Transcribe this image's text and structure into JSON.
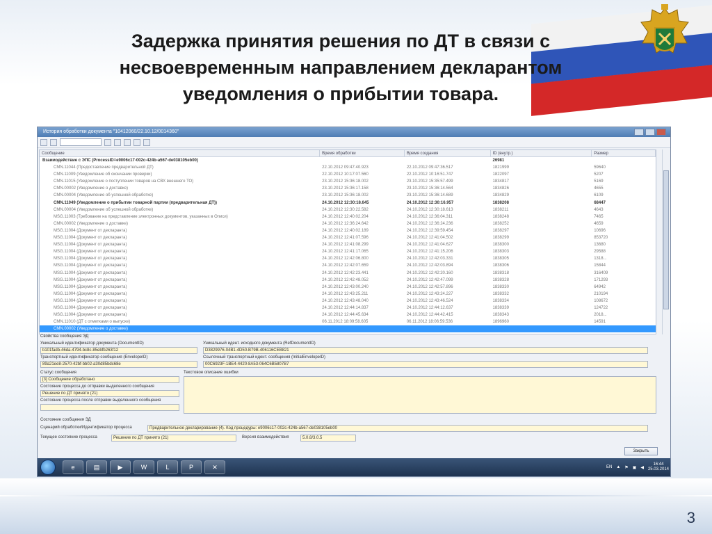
{
  "slide": {
    "title_line1": "Задержка принятия решения по ДТ в связи с",
    "title_line2": "несвоевременным направлением декларантом",
    "title_line3": "уведомления о прибытии товара.",
    "page_number": "3"
  },
  "window": {
    "title": "История обработки документа \"10412060/22.10.12/0014360\"",
    "close_button": "Закрыть"
  },
  "tree": {
    "columns": [
      "Сообщение",
      "Время обработки",
      "Время создания",
      "ID (внутр.)",
      "Размер"
    ],
    "rows": [
      {
        "name": "Взаимодействие с ЭПС (ProcessID=e9006c17-002c-424b-a567-de038105eb00)",
        "proc": "",
        "created": "",
        "id": "26981",
        "size": "",
        "bold": true
      },
      {
        "name": "CMN.11044 (Предоставление предварительной ДТ)",
        "proc": "22.10.2012 09:47:40.923",
        "created": "22.10.2012 09:47:36.517",
        "id": "1821999",
        "size": "59640"
      },
      {
        "name": "CMN.11009 (Уведомление об окончании проверки)",
        "proc": "22.10.2012 10:17:07.560",
        "created": "22.10.2012 10:16:51.747",
        "id": "1822097",
        "size": "5207"
      },
      {
        "name": "CMN.11015 (Уведомление о поступлении товаров на СВХ внешнего ТО)",
        "proc": "23.10.2012 15:36:18.002",
        "created": "23.10.2012 15:35:57.499",
        "id": "1834817",
        "size": "5169"
      },
      {
        "name": "CMN.00002 (Уведомление о доставке)",
        "proc": "23.10.2012 15:36:17.158",
        "created": "23.10.2012 15:36:14.564",
        "id": "1834826",
        "size": "4655"
      },
      {
        "name": "CMN.00004 (Уведомление об успешной обработке)",
        "proc": "23.10.2012 15:36:18.002",
        "created": "23.10.2012 15:36:14.689",
        "id": "1834829",
        "size": "6109"
      },
      {
        "name": "CMN.11049 (Уведомление о прибытии товарной партии (предварительная ДТ))",
        "proc": "24.10.2012 12:30:18.645",
        "created": "24.10.2012 12:30:16.957",
        "id": "1838208",
        "size": "68447",
        "bold": true
      },
      {
        "name": "CMN.00004 (Уведомление об успешной обработке)",
        "proc": "24.10.2012 12:30:22.582",
        "created": "24.10.2012 12:30:18.613",
        "id": "1838211",
        "size": "4643"
      },
      {
        "name": "MSG.11003 (Требование на представление электронных документов, указанных в Описи)",
        "proc": "24.10.2012 12:40:02.204",
        "created": "24.10.2012 12:36:04.311",
        "id": "1838248",
        "size": "7465"
      },
      {
        "name": "CMN.00002 (Уведомление о доставке)",
        "proc": "24.10.2012 12:36:24.642",
        "created": "24.10.2012 12:36:24.236",
        "id": "1838252",
        "size": "4659"
      },
      {
        "name": "MSG.11004 (Документ от декларанта)",
        "proc": "24.10.2012 12:40:02.189",
        "created": "24.10.2012 12:39:59.454",
        "id": "1838297",
        "size": "10696"
      },
      {
        "name": "MSG.11004 (Документ от декларанта)",
        "proc": "24.10.2012 12:41:07.596",
        "created": "24.10.2012 12:41:04.502",
        "id": "1838299",
        "size": "853720"
      },
      {
        "name": "MSG.11004 (Документ от декларанта)",
        "proc": "24.10.2012 12:41:08.299",
        "created": "24.10.2012 12:41:04.627",
        "id": "1838300",
        "size": "13680"
      },
      {
        "name": "MSG.11004 (Документ от декларанта)",
        "proc": "24.10.2012 12:41:17.065",
        "created": "24.10.2012 12:41:15.206",
        "id": "1838303",
        "size": "29588"
      },
      {
        "name": "MSG.11004 (Документ от декларанта)",
        "proc": "24.10.2012 12:42:06.800",
        "created": "24.10.2012 12:42:03.331",
        "id": "1838305",
        "size": "1318..."
      },
      {
        "name": "MSG.11004 (Документ от декларанта)",
        "proc": "24.10.2012 12:42:07.659",
        "created": "24.10.2012 12:42:03.894",
        "id": "1838306",
        "size": "15844"
      },
      {
        "name": "MSG.11004 (Документ от декларанта)",
        "proc": "24.10.2012 12:42:23.441",
        "created": "24.10.2012 12:42:20.160",
        "id": "1838318",
        "size": "316409"
      },
      {
        "name": "MSG.11004 (Документ от декларанта)",
        "proc": "24.10.2012 12:42:48.052",
        "created": "24.10.2012 12:42:47.099",
        "id": "1838328",
        "size": "171293"
      },
      {
        "name": "MSG.11004 (Документ от декларанта)",
        "proc": "24.10.2012 12:43:00.240",
        "created": "24.10.2012 12:42:57.896",
        "id": "1838330",
        "size": "64942"
      },
      {
        "name": "MSG.11004 (Документ от декларанта)",
        "proc": "24.10.2012 12:43:25.211",
        "created": "24.10.2012 12:43:24.227",
        "id": "1838332",
        "size": "210194"
      },
      {
        "name": "MSG.11004 (Документ от декларанта)",
        "proc": "24.10.2012 12:43:48.040",
        "created": "24.10.2012 12:43:46.524",
        "id": "1838334",
        "size": "108672"
      },
      {
        "name": "MSG.11004 (Документ от декларанта)",
        "proc": "24.10.2012 12:44:14.837",
        "created": "24.10.2012 12:44:12.637",
        "id": "1838339",
        "size": "124722"
      },
      {
        "name": "MSG.11004 (Документ от декларанта)",
        "proc": "24.10.2012 12:44:45.634",
        "created": "24.10.2012 12:44:42.415",
        "id": "1838343",
        "size": "2018..."
      },
      {
        "name": "CMN.11010 (ДТ с отметками о выпуске)",
        "proc": "06.11.2012 18:09:58.605",
        "created": "06.11.2012 18:06:59.536",
        "id": "1896960",
        "size": "14591"
      },
      {
        "name": "CMN.00002 (Уведомление о доставке)",
        "proc": "",
        "created": "",
        "id": "",
        "size": "",
        "selected": true
      }
    ]
  },
  "props": {
    "section_title": "Свойства сообщения ЭД",
    "docid_label": "Уникальный идентификатор документа (DocumentID)",
    "docid_value": "b101fadb-46da-4794-bc8c-85ebfb263f12",
    "refdocid_label": "Уникальный идент. исходного документа (RefDocumentID)",
    "refdocid_value": "D3829976-04B1-4D50-B79B-406116CEB821",
    "envelope_label": "Транспортный идентификатор сообщения (EnvelopeID)",
    "envelope_value": "89a21ee8-2570-42bf-bb02-a30d85bdc68e",
    "init_envelope_label": "Ссылочный транспортный идент. сообщения (InitialEnvelopeID)",
    "init_envelope_value": "00C6923F-1BE4-4420-8A53-064C6B5807B7",
    "status_label": "Статус сообщения",
    "status_value": "[3] Сообщение обработано",
    "error_label": "Текстовое описание ошибки",
    "before_label": "Состояние процесса до отправки выделенного сообщения",
    "before_value": "Решение по ДТ принято (21)",
    "after_label": "Состояние процесса после отправки выделенного сообщения",
    "after_value": ""
  },
  "state": {
    "section_title": "Состояние сообщения ЭД",
    "scenario_label": "Сценарий обработки/Идентификатор процесса",
    "scenario_value": "Предварительное декларирование (4). Код процедуры: e9006c17-002c-424b-a567-de038105eb00",
    "current_label": "Текущее состояние процесса",
    "current_value": "Решение по ДТ принято (21)",
    "version_label": "Версия взаимодействия",
    "version_value": "5.0.8/3.0.5"
  },
  "taskbar": {
    "lang": "EN",
    "time": "16:44",
    "date": "25.03.2014"
  }
}
